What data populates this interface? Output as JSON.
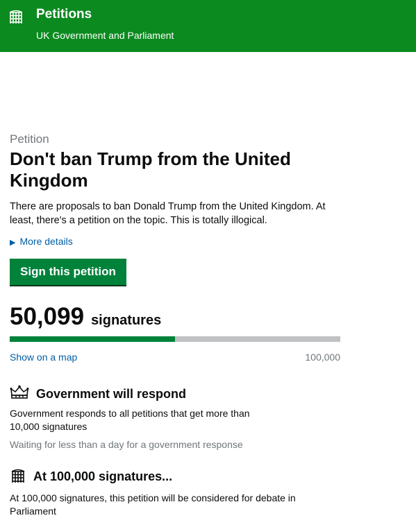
{
  "header": {
    "title": "Petitions",
    "subtitle": "UK Government and Parliament",
    "logo_icon": "portcullis-icon",
    "background": "#0b8a1f"
  },
  "petition": {
    "kicker": "Petition",
    "title": "Don't ban Trump from the United Kingdom",
    "summary": "There are proposals to ban Donald Trump from the United Kingdom. At least, there's a petition on the topic. This is totally illogical.",
    "more_details": "More details",
    "sign_label": "Sign this petition"
  },
  "signatures": {
    "count": "50,099",
    "label": "signatures",
    "progress_fraction": 0.501,
    "map_link": "Show on a map",
    "target": "100,000"
  },
  "government": {
    "icon": "crown-icon",
    "heading": "Government will respond",
    "text": "Government responds to all petitions that get more than 10,000 signatures",
    "status": "Waiting for less than a day for a government response"
  },
  "parliament": {
    "icon": "portcullis-icon",
    "heading": "At 100,000 signatures...",
    "text": "At 100,000 signatures, this petition will be considered for debate in Parliament"
  },
  "colors": {
    "button": "#00823b",
    "link": "#005ea5",
    "progress_track": "#bfc1c3"
  }
}
